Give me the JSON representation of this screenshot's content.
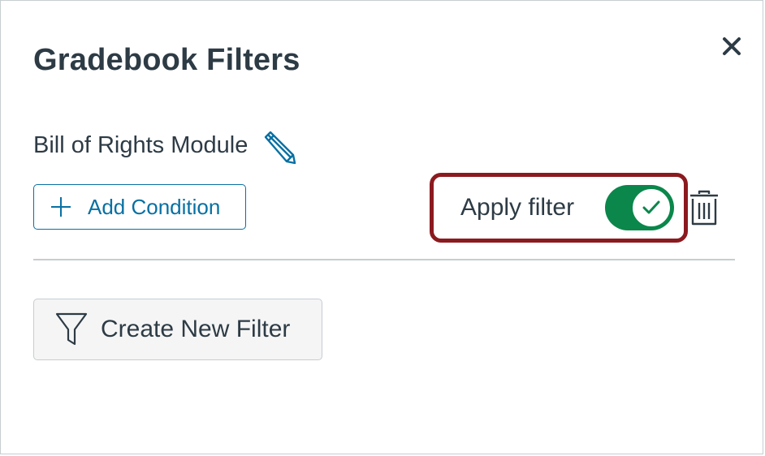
{
  "dialog": {
    "title": "Gradebook Filters",
    "close_icon": "close-icon"
  },
  "filter": {
    "name": "Bill of Rights Module",
    "edit_icon": "pencil-icon",
    "add_condition_label": "Add Condition",
    "apply_label": "Apply filter",
    "apply_enabled": true,
    "delete_icon": "trash-icon"
  },
  "actions": {
    "create_filter_label": "Create New Filter",
    "create_filter_icon": "funnel-icon"
  },
  "colors": {
    "accent_blue": "#0770a3",
    "toggle_on": "#0b874b",
    "highlight_border": "#8b1a1f",
    "text": "#2d3b45"
  }
}
